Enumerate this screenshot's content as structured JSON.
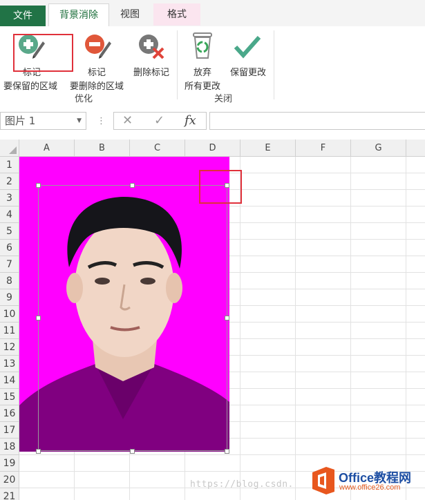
{
  "tabs": {
    "file": "文件",
    "background_removal": "背景消除",
    "view": "视图",
    "format": "格式"
  },
  "ribbon": {
    "mark_keep": {
      "line1": "标记",
      "line2": "要保留的区域",
      "icon": "plus-circle-pencil-icon"
    },
    "mark_remove": {
      "line1": "标记",
      "line2": "要删除的区域",
      "icon": "minus-circle-pencil-icon"
    },
    "delete_mark": {
      "line1": "删除标记",
      "icon": "delete-mark-icon"
    },
    "discard": {
      "line1": "放弃",
      "line2": "所有更改",
      "icon": "recycle-bin-icon"
    },
    "keep_changes": {
      "line1": "保留更改",
      "icon": "checkmark-icon"
    },
    "group_refine": "优化",
    "group_close": "关闭"
  },
  "formula_bar": {
    "name_box": "图片 1",
    "cancel_icon": "✕",
    "enter_icon": "✓",
    "fx_label": "fx",
    "formula": ""
  },
  "sheet": {
    "columns": [
      "A",
      "B",
      "C",
      "D",
      "E",
      "F",
      "G"
    ],
    "rows": [
      "1",
      "2",
      "3",
      "4",
      "5",
      "6",
      "7",
      "8",
      "9",
      "10",
      "11",
      "12",
      "13",
      "14",
      "15",
      "16",
      "17",
      "18",
      "19",
      "20",
      "21"
    ]
  },
  "watermark": {
    "url_text": "https://blog.csdn.",
    "logo_text": "Office教程网",
    "logo_url": "www.office26.com"
  },
  "colors": {
    "accent": "#217346",
    "background_removed": "#ff00ff",
    "highlight": "#e0303a"
  }
}
